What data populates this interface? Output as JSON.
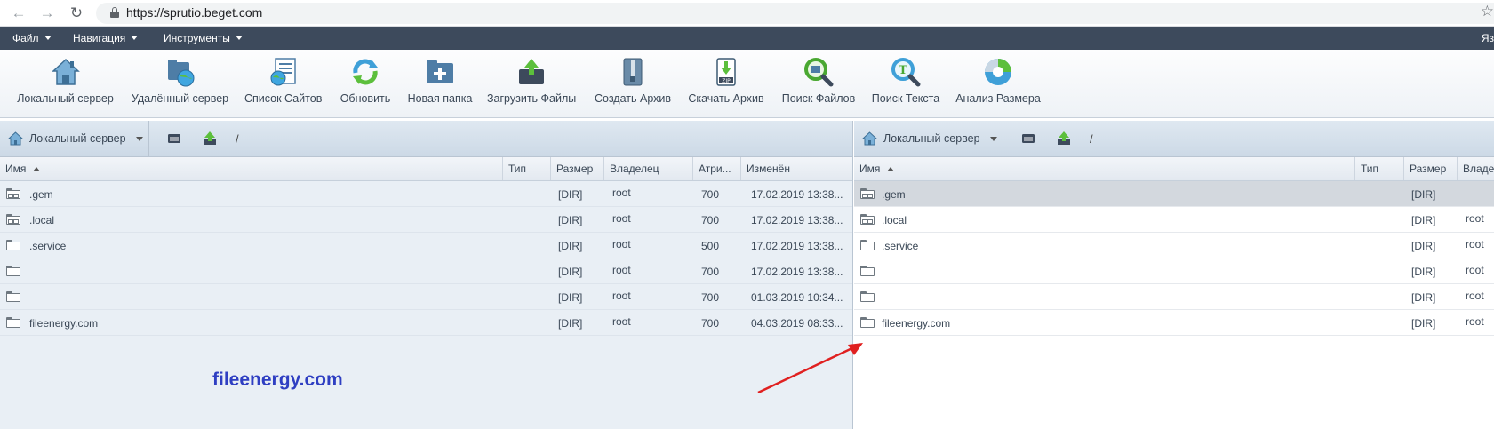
{
  "browser": {
    "url": "https://sprutio.beget.com"
  },
  "menu": {
    "items": [
      "Файл",
      "Навигация",
      "Инструменты"
    ],
    "right_label": "Яз"
  },
  "toolbar": [
    {
      "name": "local-server",
      "label": "Локальный сервер",
      "icon": "house-icon"
    },
    {
      "name": "remote-server",
      "label": "Удалённый сервер",
      "icon": "globe-folder-icon"
    },
    {
      "name": "site-list",
      "label": "Список Сайтов",
      "icon": "site-list-icon"
    },
    {
      "name": "refresh",
      "label": "Обновить",
      "icon": "refresh-icon"
    },
    {
      "name": "new-folder",
      "label": "Новая папка",
      "icon": "new-folder-icon"
    },
    {
      "name": "upload-files",
      "label": "Загрузить Файлы",
      "icon": "upload-icon"
    },
    {
      "name": "create-archive",
      "label": "Создать Архив",
      "icon": "archive-icon"
    },
    {
      "name": "download-archive",
      "label": "Скачать Архив",
      "icon": "zip-download-icon"
    },
    {
      "name": "search-files",
      "label": "Поиск Файлов",
      "icon": "search-files-icon"
    },
    {
      "name": "search-text",
      "label": "Поиск Текста",
      "icon": "search-text-icon"
    },
    {
      "name": "size-analysis",
      "label": "Анализ Размера",
      "icon": "pie-chart-icon"
    }
  ],
  "left_panel": {
    "server": "Локальный сервер",
    "path": "/",
    "columns": [
      "Имя",
      "Тип",
      "Размер",
      "Владелец",
      "Атри...",
      "Изменён"
    ],
    "rows": [
      {
        "name": ".gem",
        "type": "",
        "size": "[DIR]",
        "owner": "root",
        "attrs": "700",
        "modified": "17.02.2019 13:38...",
        "special": true
      },
      {
        "name": ".local",
        "type": "",
        "size": "[DIR]",
        "owner": "root",
        "attrs": "700",
        "modified": "17.02.2019 13:38...",
        "special": true
      },
      {
        "name": ".service",
        "type": "",
        "size": "[DIR]",
        "owner": "root",
        "attrs": "500",
        "modified": "17.02.2019 13:38...",
        "special": false
      },
      {
        "name": "",
        "type": "",
        "size": "[DIR]",
        "owner": "root",
        "attrs": "700",
        "modified": "17.02.2019 13:38...",
        "special": false
      },
      {
        "name": "",
        "type": "",
        "size": "[DIR]",
        "owner": "root",
        "attrs": "700",
        "modified": "01.03.2019 10:34...",
        "special": false
      },
      {
        "name": "fileenergy.com",
        "type": "",
        "size": "[DIR]",
        "owner": "root",
        "attrs": "700",
        "modified": "04.03.2019 08:33...",
        "special": false
      }
    ]
  },
  "right_panel": {
    "server": "Локальный сервер",
    "path": "/",
    "columns": [
      "Имя",
      "Тип",
      "Размер",
      "Владе"
    ],
    "rows": [
      {
        "name": ".gem",
        "size": "[DIR]",
        "owner": "",
        "special": true,
        "selected": true
      },
      {
        "name": ".local",
        "size": "[DIR]",
        "owner": "root",
        "special": true
      },
      {
        "name": ".service",
        "size": "[DIR]",
        "owner": "root",
        "special": false
      },
      {
        "name": "",
        "size": "[DIR]",
        "owner": "root",
        "special": false
      },
      {
        "name": "",
        "size": "[DIR]",
        "owner": "root",
        "special": false
      },
      {
        "name": "fileenergy.com",
        "size": "[DIR]",
        "owner": "root",
        "special": false
      }
    ]
  },
  "annotation": {
    "watermark": "fileenergy.com",
    "arrow_color": "#e02020"
  }
}
